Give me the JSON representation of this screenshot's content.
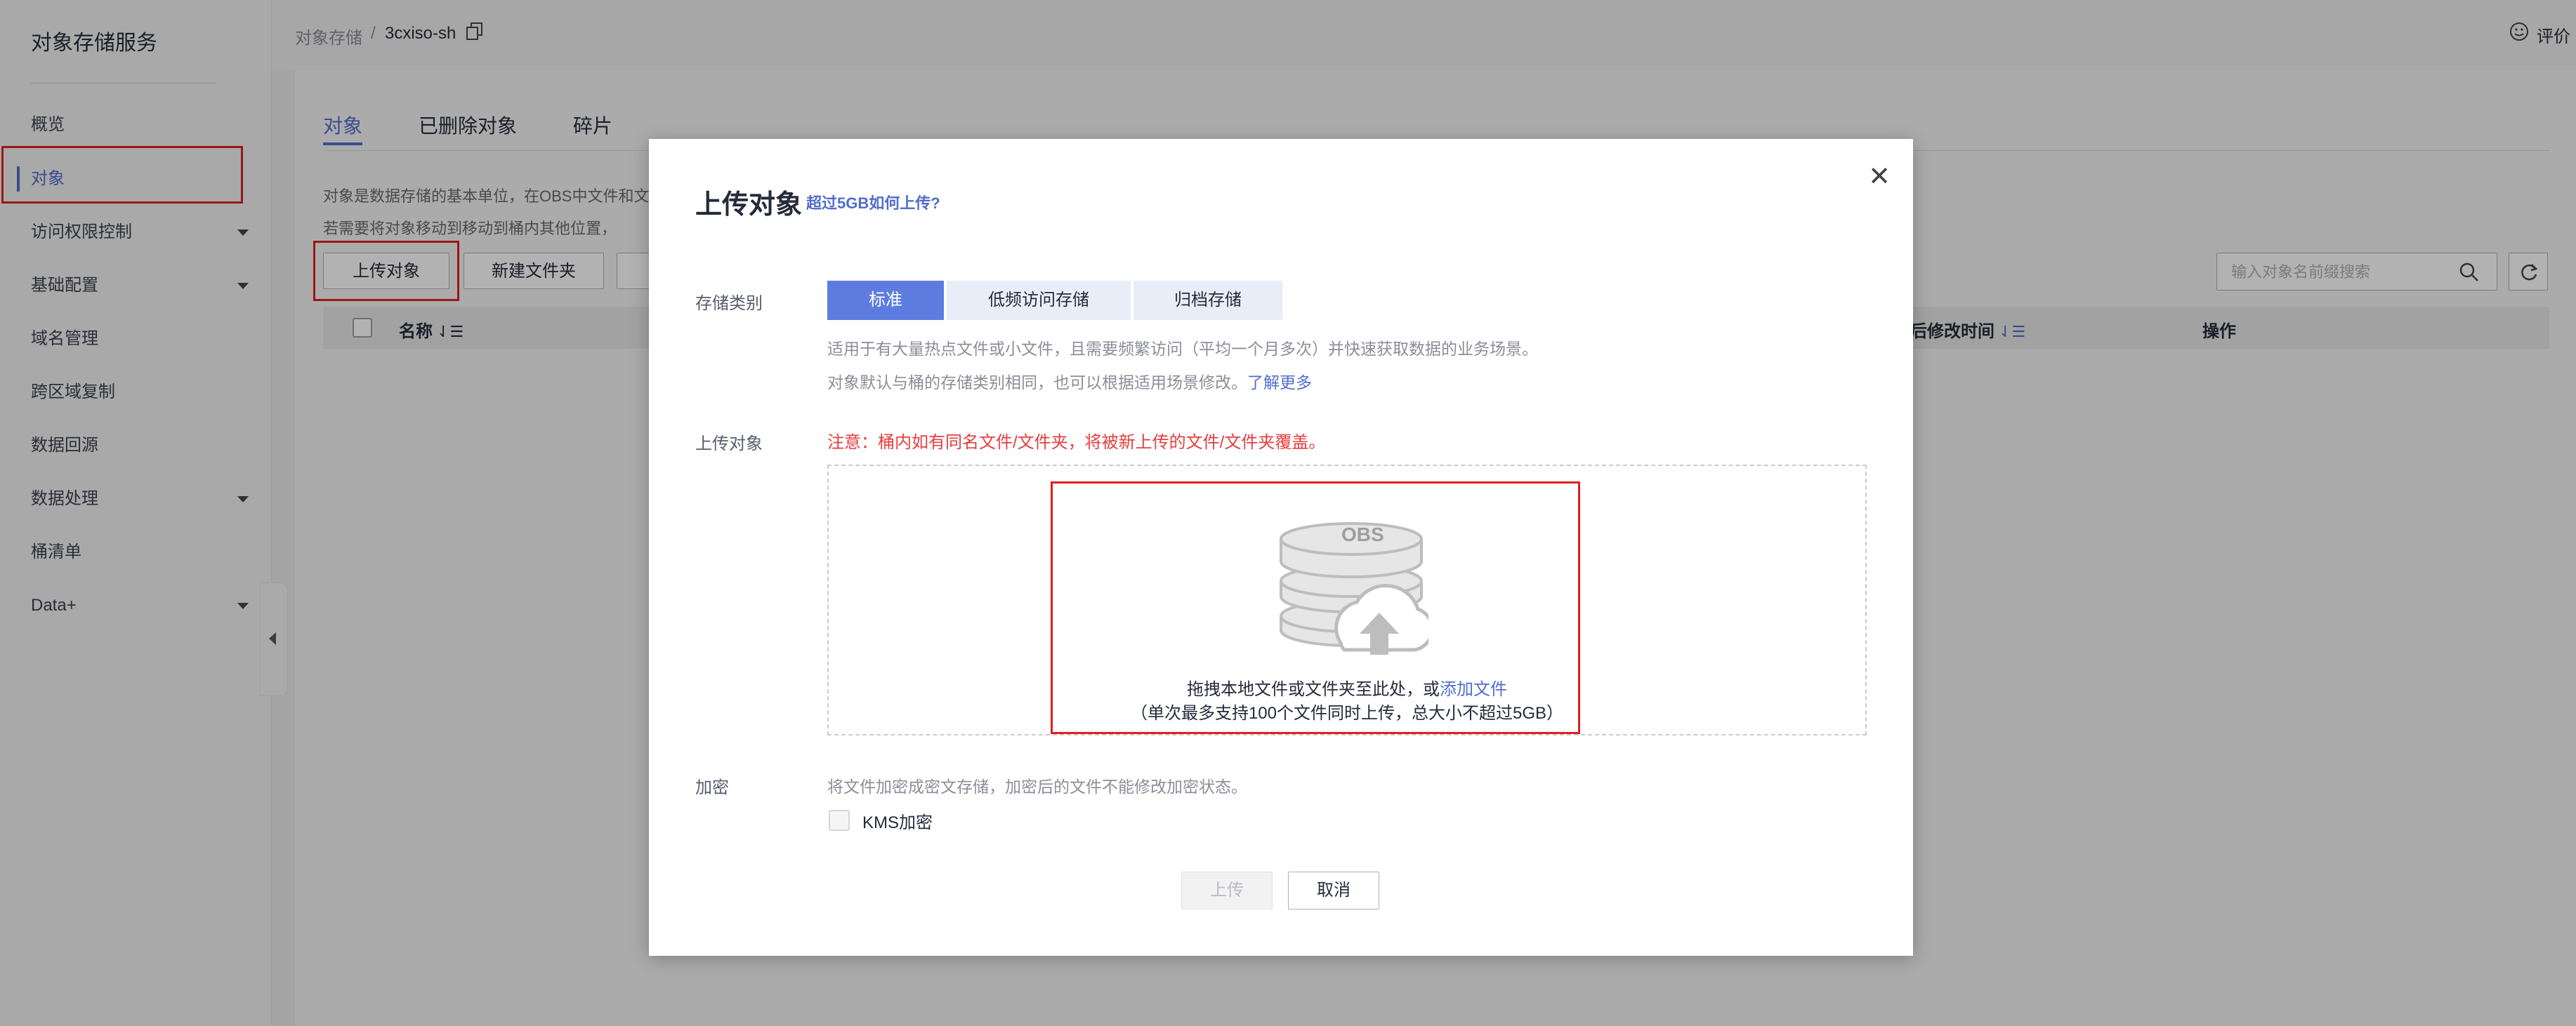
{
  "sidebar": {
    "title": "对象存储服务",
    "items": [
      {
        "label": "概览"
      },
      {
        "label": "对象"
      },
      {
        "label": "访问权限控制"
      },
      {
        "label": "基础配置"
      },
      {
        "label": "域名管理"
      },
      {
        "label": "跨区域复制"
      },
      {
        "label": "数据回源"
      },
      {
        "label": "数据处理"
      },
      {
        "label": "桶清单"
      },
      {
        "label": "Data+"
      }
    ]
  },
  "breadcrumb": {
    "root": "对象存储",
    "separator": "/",
    "bucket": "3cxiso-sh"
  },
  "topbar": {
    "feedback": "评价"
  },
  "tabs": [
    {
      "label": "对象"
    },
    {
      "label": "已删除对象"
    },
    {
      "label": "碎片"
    }
  ],
  "description": {
    "line1": "对象是数据存储的基本单位，在OBS中文件和文",
    "line2": "若需要将对象移动到移动到桶内其他位置，"
  },
  "toolbar": {
    "upload_label": "上传对象",
    "new_folder_label": "新建文件夹",
    "search_placeholder": "输入对象名前缀搜索"
  },
  "table": {
    "col_name": "名称",
    "col_modified": "后修改时间",
    "col_actions": "操作"
  },
  "modal": {
    "title": "上传对象",
    "help_link": "超过5GB如何上传?",
    "storage_label": "存储类别",
    "storage_options": [
      {
        "label": "标准",
        "selected": true
      },
      {
        "label": "低频访问存储",
        "selected": false
      },
      {
        "label": "归档存储",
        "selected": false
      }
    ],
    "storage_hint1": "适用于有大量热点文件或小文件，且需要频繁访问（平均一个月多次）并快速获取数据的业务场景。",
    "storage_hint2_prefix": "对象默认与桶的存储类别相同，也可以根据适用场景修改。",
    "storage_hint2_link": "了解更多",
    "upload_label": "上传对象",
    "upload_warning": "注意：桶内如有同名文件/文件夹，将被新上传的文件/文件夹覆盖。",
    "obs_badge": "OBS",
    "drop_text_prefix": "拖拽本地文件或文件夹至此处，或",
    "drop_text_link": "添加文件",
    "drop_limit": "（单次最多支持100个文件同时上传，总大小不超过5GB）",
    "encrypt_label": "加密",
    "encrypt_hint": "将文件加密成密文存储，加密后的文件不能修改加密状态。",
    "kms_label": "KMS加密",
    "upload_button": "上传",
    "cancel_button": "取消"
  },
  "colors": {
    "accent": "#526ecc",
    "segment_active": "#5e7ce0",
    "warning": "#e53e3e",
    "annotation": "#e02020"
  }
}
